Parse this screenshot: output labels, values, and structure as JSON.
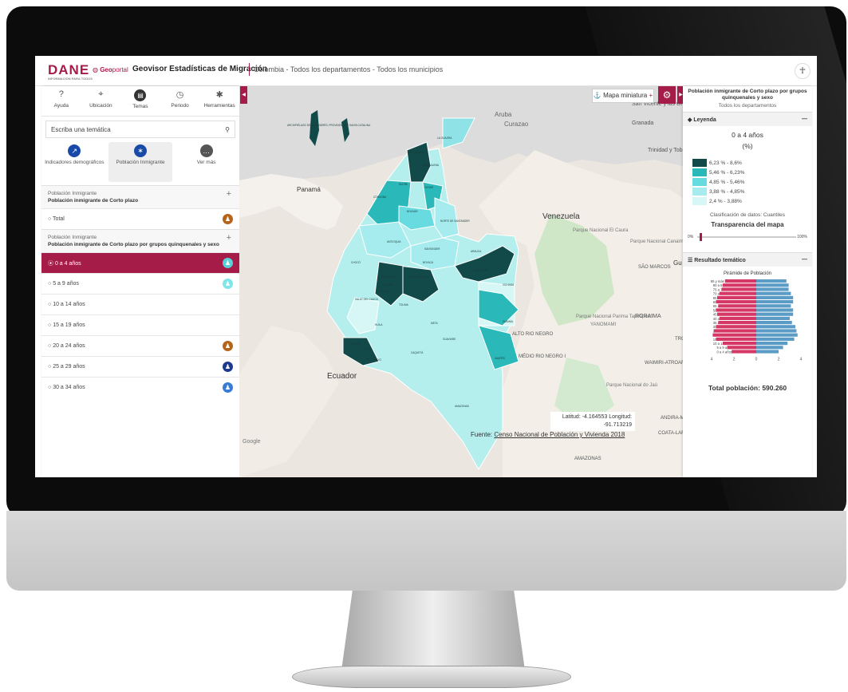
{
  "header": {
    "logo": "DANE",
    "logo_sub": "INFORMACIÓN PARA TODOS",
    "geo_brand": "Geo",
    "geo_portal": "portal",
    "app_title": "Geovisor Estadísticas de Migración",
    "breadcrumb": "Colombia - Todos los departamentos - Todos los municipios"
  },
  "toolbar": [
    {
      "label": "Ayuda",
      "icon": "?"
    },
    {
      "label": "Ubicación",
      "icon": "⌖"
    },
    {
      "label": "Temas",
      "icon": "▤"
    },
    {
      "label": "Periodo",
      "icon": "◷"
    },
    {
      "label": "Herramientas",
      "icon": "✱"
    }
  ],
  "search": {
    "placeholder": "Escriba una temática"
  },
  "categories": [
    {
      "label": "Indicadores demográficos",
      "icon": "↗"
    },
    {
      "label": "Población Inmigrante",
      "icon": "✶"
    },
    {
      "label": "Ver más",
      "icon": "…"
    }
  ],
  "groups": [
    {
      "title": "Población Inmigrante",
      "subtitle": "Población inmigrante de Corto plazo"
    },
    {
      "title": "Población Inmigrante",
      "subtitle": "Población inmigrante de Corto plazo por grupos quinquenales y sexo"
    }
  ],
  "total_row": "Total",
  "age_rows": [
    "0 a 4 años",
    "5 a 9 años",
    "10 a 14 años",
    "15 a 19 años",
    "20 a 24 años",
    "25 a 29 años",
    "30 a 34 años"
  ],
  "age_icon_colors": [
    "#5ad1d8",
    "#7fe6e9",
    "#ffffff",
    "#ffffff",
    "#b5641b",
    "#1e3a8c",
    "#3a7bd5"
  ],
  "map": {
    "miniature_button": "Mapa miniatura",
    "coords": "Latitud: -4.164553 Longitud: -91.713219",
    "source_prefix": "Fuente: ",
    "source_link": "Censo Nacional de Población y Vivienda 2018",
    "google": "Google",
    "place_labels": [
      "Aruba",
      "Curazao",
      "Panamá",
      "Venezuela",
      "Ecuador",
      "Granada",
      "San Vicente y las Granadinas",
      "Trinidad y Tobago",
      "YANOMAMI",
      "RORAIMA",
      "ALTO RIO NEGRO",
      "MÉDIO RIO NEGRO I",
      "WAIMIRI-ATROARI",
      "SÃO MARCOS",
      "ANDIRA-MARAU",
      "COATA-LARANJAL",
      "Parque Nacional El Caura",
      "Parque Nacional Canaima",
      "Parque Nacional Parima Tapirapecó",
      "Parque Nacional do Jaú",
      "AMAZONAS",
      "Gu",
      "TRO"
    ],
    "dept_labels": [
      "ARCHIPIÉLAGO DE SAN ANDRÉS, PROVIDENCIA Y SANTA CATALINA",
      "LA GUAJIRA",
      "ATLÁNTICO",
      "MAGDALENA",
      "CESAR",
      "SUCRE",
      "CÓRDOBA",
      "BOLÍVAR",
      "NORTE DE SANTANDER",
      "ANTIOQUIA",
      "SANTANDER",
      "ARAUCA",
      "CHOCÓ",
      "BOYACÁ",
      "CASANARE",
      "RISARALDA",
      "CALDAS",
      "CUNDINAMARCA",
      "VICHADA",
      "QUINDIO",
      "VALLE DEL CAUCA",
      "TOLIMA",
      "META",
      "HUILA",
      "CAUCA",
      "NARIÑO",
      "GUAINÍA",
      "GUAVIARE",
      "PUTUMAYO",
      "CAQUETÁ",
      "VAUPÉS",
      "AMAZONAS"
    ]
  },
  "right_panel": {
    "title": "Población inmigrante de Corto plazo por grupos quinquenales y sexo",
    "subtitle": "Todos los departamentos",
    "legend_header": "Leyenda",
    "legend_title": "0 a 4 años",
    "legend_unit": "(%)",
    "legend": [
      {
        "label": "6,23 % - 8,6%",
        "color": "#124a4a"
      },
      {
        "label": "5,46 % - 6,23%",
        "color": "#2bb8b8"
      },
      {
        "label": "4,85 % - 5,46%",
        "color": "#68dbe0"
      },
      {
        "label": "3,88 % - 4,85%",
        "color": "#a6ecee"
      },
      {
        "label": "2,4 % - 3,88%",
        "color": "#d6f7f6"
      }
    ],
    "classification": "Clasificación de datos: Cuantiles",
    "transparency_title": "Transparencia del mapa",
    "slider_min": "0%",
    "slider_max": "100%",
    "transparency_value": 0.02,
    "result_header": "Resultado temático",
    "pyramid_title": "Pirámide de Población",
    "total": "Total población: 590.260"
  },
  "chart_data": {
    "type": "bar",
    "title": "Pirámide de Población",
    "categories": [
      "85 y más años",
      "80 a 84 años",
      "75 a 79 años",
      "70 a 74 años",
      "65 a 69 años",
      "60 a 64 años",
      "55 a 59 años",
      "50 a 54 años",
      "45 a 49 años",
      "40 a 44 años",
      "35 a 39 años",
      "30 a 34 años",
      "25 a 29 años",
      "20 a 24 años",
      "15 a 19 años",
      "10 a 14 años",
      "5 a 9 años",
      "0 a 4 años"
    ],
    "series": [
      {
        "color": "#d63866",
        "values": [
          2.8,
          3.0,
          3.1,
          3.3,
          3.5,
          3.6,
          3.4,
          3.6,
          3.5,
          3.3,
          3.4,
          3.6,
          3.8,
          3.9,
          3.6,
          3.0,
          2.6,
          2.2
        ]
      },
      {
        "color": "#5b9cc6",
        "values": [
          2.7,
          2.9,
          2.9,
          3.1,
          3.3,
          3.3,
          3.1,
          3.3,
          3.3,
          3.0,
          3.2,
          3.5,
          3.6,
          3.7,
          3.4,
          2.8,
          2.4,
          2.0
        ]
      }
    ],
    "xticks": [
      "4",
      "2",
      "0",
      "2",
      "4"
    ],
    "xlim": [
      -4,
      4
    ],
    "grid": false,
    "legend": "none"
  }
}
